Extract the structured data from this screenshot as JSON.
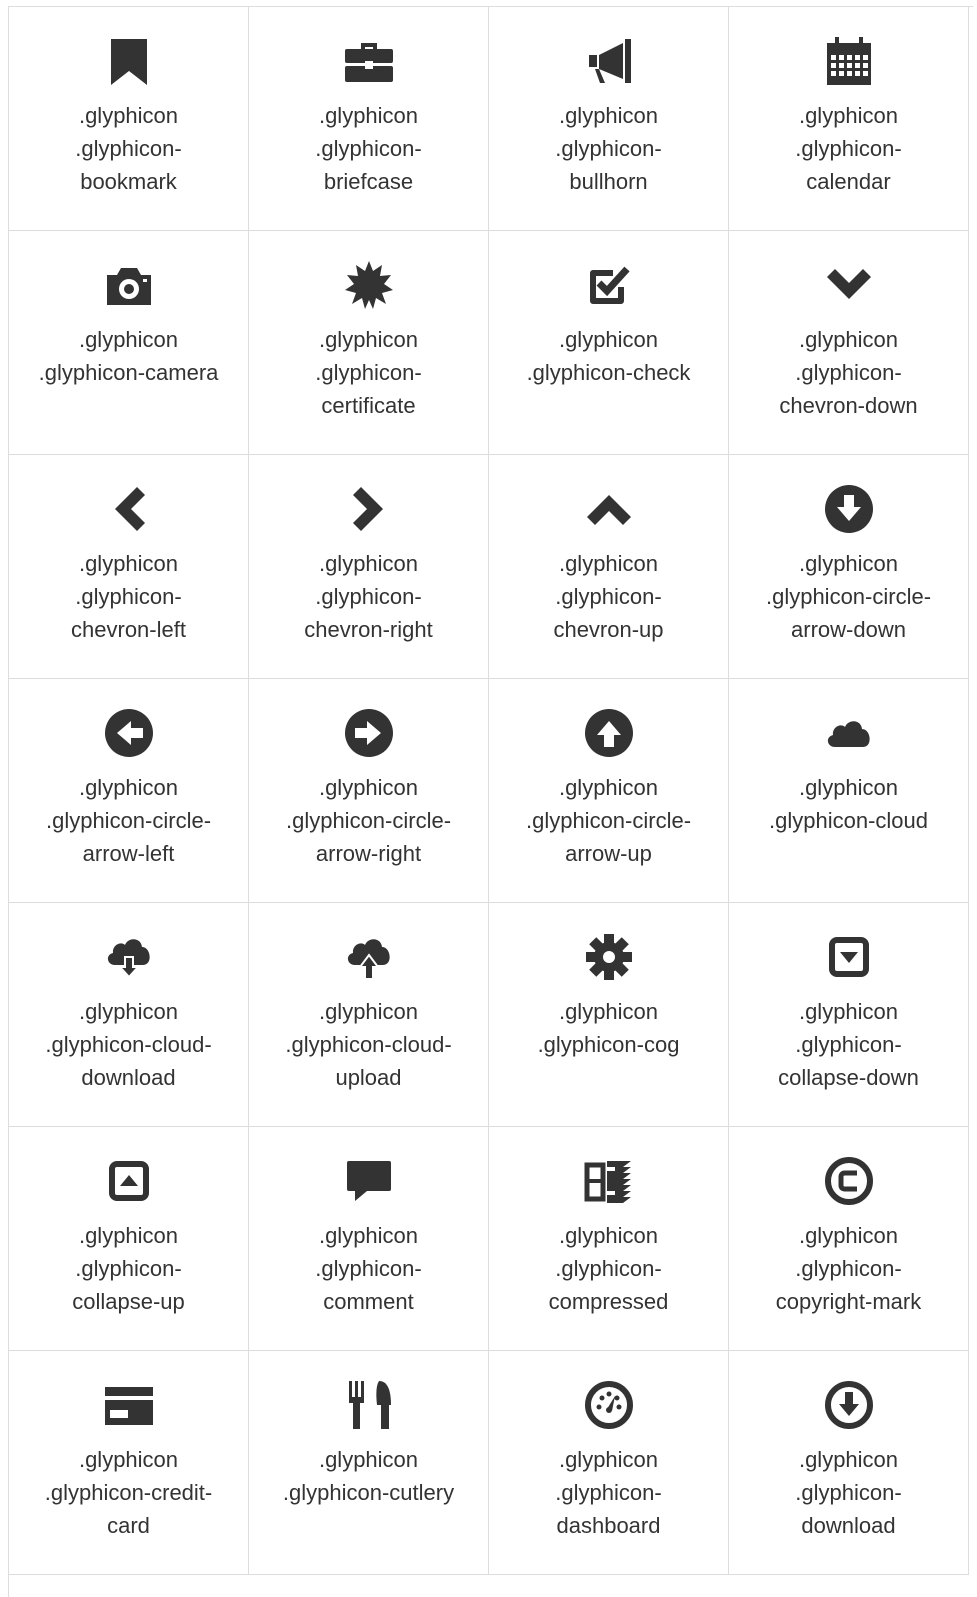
{
  "icons": [
    {
      "name": "bookmark-icon",
      "line1": ".glyphicon",
      "line2": ".glyphicon-",
      "line3": "bookmark"
    },
    {
      "name": "briefcase-icon",
      "line1": ".glyphicon",
      "line2": ".glyphicon-",
      "line3": "briefcase"
    },
    {
      "name": "bullhorn-icon",
      "line1": ".glyphicon",
      "line2": ".glyphicon-",
      "line3": "bullhorn"
    },
    {
      "name": "calendar-icon",
      "line1": ".glyphicon",
      "line2": ".glyphicon-",
      "line3": "calendar"
    },
    {
      "name": "camera-icon",
      "line1": ".glyphicon",
      "line2": ".glyphicon-camera",
      "line3": ""
    },
    {
      "name": "certificate-icon",
      "line1": ".glyphicon",
      "line2": ".glyphicon-",
      "line3": "certificate"
    },
    {
      "name": "check-icon",
      "line1": ".glyphicon",
      "line2": ".glyphicon-check",
      "line3": ""
    },
    {
      "name": "chevron-down-icon",
      "line1": ".glyphicon",
      "line2": ".glyphicon-",
      "line3": "chevron-down"
    },
    {
      "name": "chevron-left-icon",
      "line1": ".glyphicon",
      "line2": ".glyphicon-",
      "line3": "chevron-left"
    },
    {
      "name": "chevron-right-icon",
      "line1": ".glyphicon",
      "line2": ".glyphicon-",
      "line3": "chevron-right"
    },
    {
      "name": "chevron-up-icon",
      "line1": ".glyphicon",
      "line2": ".glyphicon-",
      "line3": "chevron-up"
    },
    {
      "name": "circle-arrow-down-icon",
      "line1": ".glyphicon",
      "line2": ".glyphicon-circle-",
      "line3": "arrow-down"
    },
    {
      "name": "circle-arrow-left-icon",
      "line1": ".glyphicon",
      "line2": ".glyphicon-circle-",
      "line3": "arrow-left"
    },
    {
      "name": "circle-arrow-right-icon",
      "line1": ".glyphicon",
      "line2": ".glyphicon-circle-",
      "line3": "arrow-right"
    },
    {
      "name": "circle-arrow-up-icon",
      "line1": ".glyphicon",
      "line2": ".glyphicon-circle-",
      "line3": "arrow-up"
    },
    {
      "name": "cloud-icon",
      "line1": ".glyphicon",
      "line2": ".glyphicon-cloud",
      "line3": ""
    },
    {
      "name": "cloud-download-icon",
      "line1": ".glyphicon",
      "line2": ".glyphicon-cloud-",
      "line3": "download"
    },
    {
      "name": "cloud-upload-icon",
      "line1": ".glyphicon",
      "line2": ".glyphicon-cloud-",
      "line3": "upload"
    },
    {
      "name": "cog-icon",
      "line1": ".glyphicon",
      "line2": ".glyphicon-cog",
      "line3": ""
    },
    {
      "name": "collapse-down-icon",
      "line1": ".glyphicon",
      "line2": ".glyphicon-",
      "line3": "collapse-down"
    },
    {
      "name": "collapse-up-icon",
      "line1": ".glyphicon",
      "line2": ".glyphicon-",
      "line3": "collapse-up"
    },
    {
      "name": "comment-icon",
      "line1": ".glyphicon",
      "line2": ".glyphicon-",
      "line3": "comment"
    },
    {
      "name": "compressed-icon",
      "line1": ".glyphicon",
      "line2": ".glyphicon-",
      "line3": "compressed"
    },
    {
      "name": "copyright-mark-icon",
      "line1": ".glyphicon",
      "line2": ".glyphicon-",
      "line3": "copyright-mark"
    },
    {
      "name": "credit-card-icon",
      "line1": ".glyphicon",
      "line2": ".glyphicon-credit-",
      "line3": "card"
    },
    {
      "name": "cutlery-icon",
      "line1": ".glyphicon",
      "line2": ".glyphicon-cutlery",
      "line3": ""
    },
    {
      "name": "dashboard-icon",
      "line1": ".glyphicon",
      "line2": ".glyphicon-",
      "line3": "dashboard"
    },
    {
      "name": "download-icon",
      "line1": ".glyphicon",
      "line2": ".glyphicon-",
      "line3": "download"
    }
  ]
}
